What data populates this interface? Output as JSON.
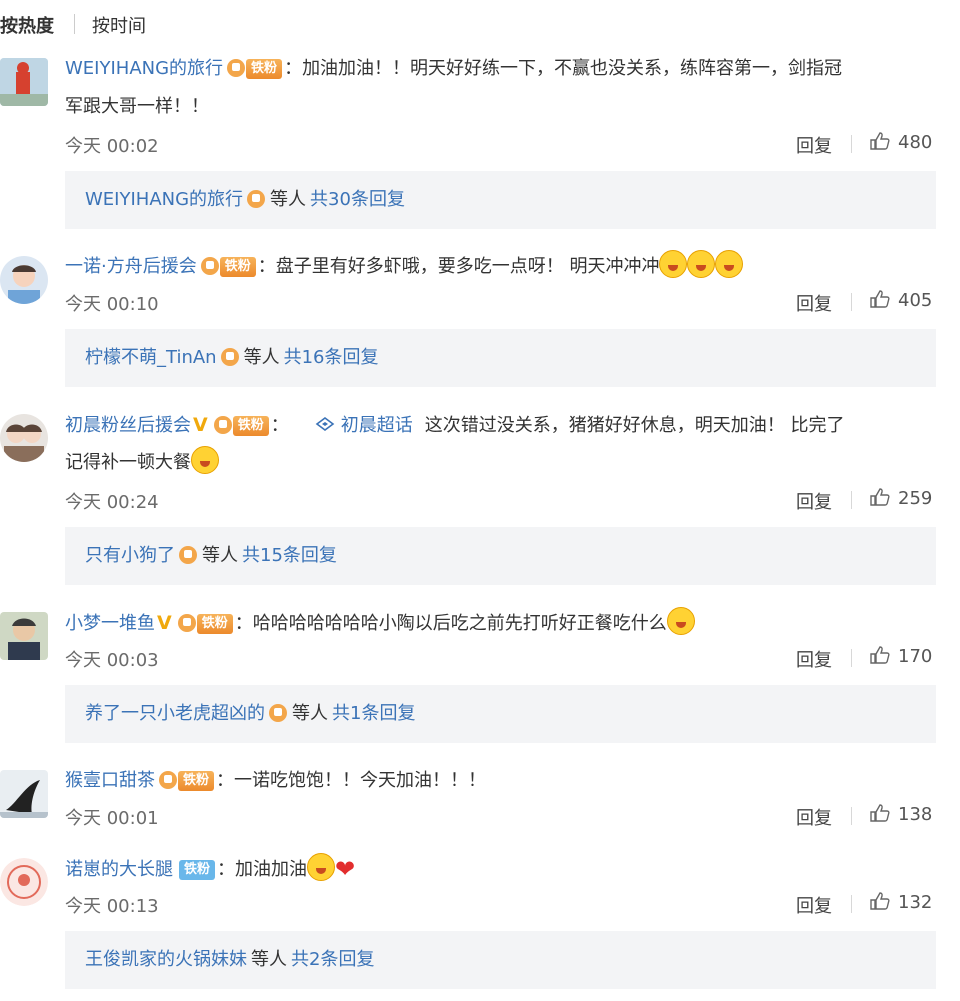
{
  "sort_tabs": [
    "按热度",
    "按时间"
  ],
  "labels": {
    "reply": "回复",
    "others": "等人",
    "fan_badge": "铁粉"
  },
  "comments": [
    {
      "username": "WEIYIHANG的旅行",
      "line1": "加油加油！！明天好好练一下，不赢也没关系，练阵容第一，剑指冠",
      "line2": "军跟大哥一样！！",
      "time": "今天 00:02",
      "likes": "480",
      "reply_user": "WEIYIHANG的旅行",
      "reply_count": "共30条回复"
    },
    {
      "username": "一诺·方舟后援会",
      "line1": "盘子里有好多虾哦，要多吃一点呀！ 明天冲冲冲",
      "time": "今天 00:10",
      "likes": "405",
      "reply_user": "柠檬不萌_TinAn",
      "reply_count": "共16条回复"
    },
    {
      "username": "初晨粉丝后援会",
      "topic": "初晨超话",
      "line1": "这次错过没关系，猪猪好好休息，明天加油！ 比完了",
      "line2": "记得补一顿大餐",
      "time": "今天 00:24",
      "likes": "259",
      "reply_user": "只有小狗了",
      "reply_count": "共15条回复"
    },
    {
      "username": "小梦一堆鱼",
      "line1": "哈哈哈哈哈哈哈小陶以后吃之前先打听好正餐吃什么",
      "time": "今天 00:03",
      "likes": "170",
      "reply_user": "养了一只小老虎超凶的",
      "reply_count": "共1条回复"
    },
    {
      "username": "猴壹口甜茶",
      "line1": "一诺吃饱饱！！今天加油！！！",
      "time": "今天 00:01",
      "likes": "138"
    },
    {
      "username": "诺崽的大长腿",
      "line1": "加油加油",
      "time": "今天 00:13",
      "likes": "132",
      "reply_user": "王俊凯家的火锅妹妹",
      "reply_count": "共2条回复"
    }
  ]
}
